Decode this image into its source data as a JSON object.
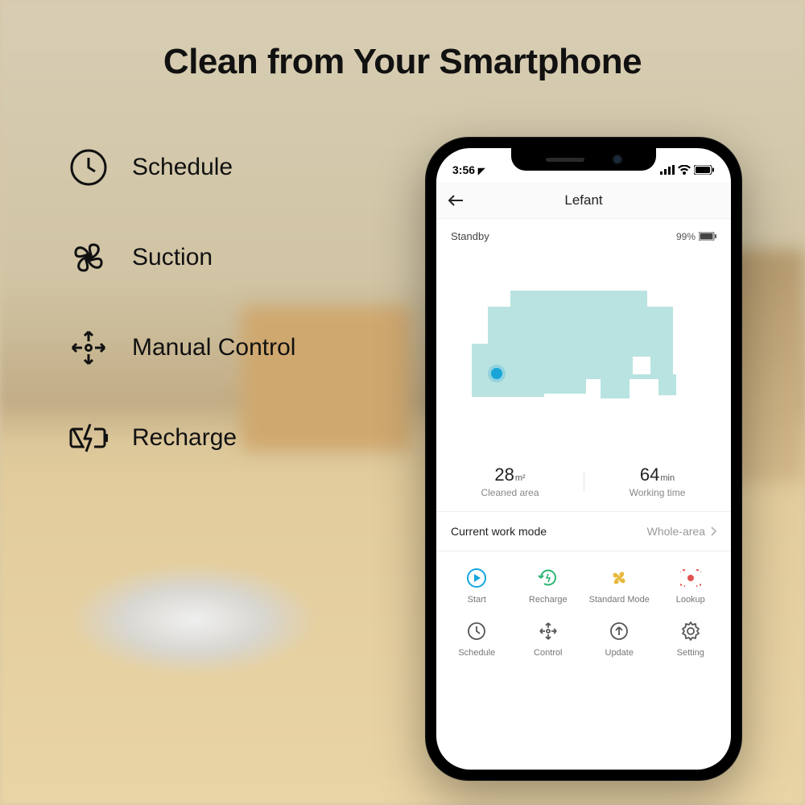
{
  "headline": "Clean from Your Smartphone",
  "features": [
    {
      "label": "Schedule"
    },
    {
      "label": "Suction"
    },
    {
      "label": "Manual Control"
    },
    {
      "label": "Recharge"
    }
  ],
  "phone": {
    "status_time": "3:56",
    "app_title": "Lefant",
    "device_status": "Standby",
    "battery_pct": "99%",
    "stats": {
      "area_value": "28",
      "area_unit": "m²",
      "area_label": "Cleaned area",
      "time_value": "64",
      "time_unit": "min",
      "time_label": "Working time"
    },
    "mode_row": {
      "label": "Current work mode",
      "value": "Whole-area"
    },
    "actions": [
      {
        "label": "Start"
      },
      {
        "label": "Recharge"
      },
      {
        "label": "Standard Mode"
      },
      {
        "label": "Lookup"
      },
      {
        "label": "Schedule"
      },
      {
        "label": "Control"
      },
      {
        "label": "Update"
      },
      {
        "label": "Setting"
      }
    ]
  }
}
